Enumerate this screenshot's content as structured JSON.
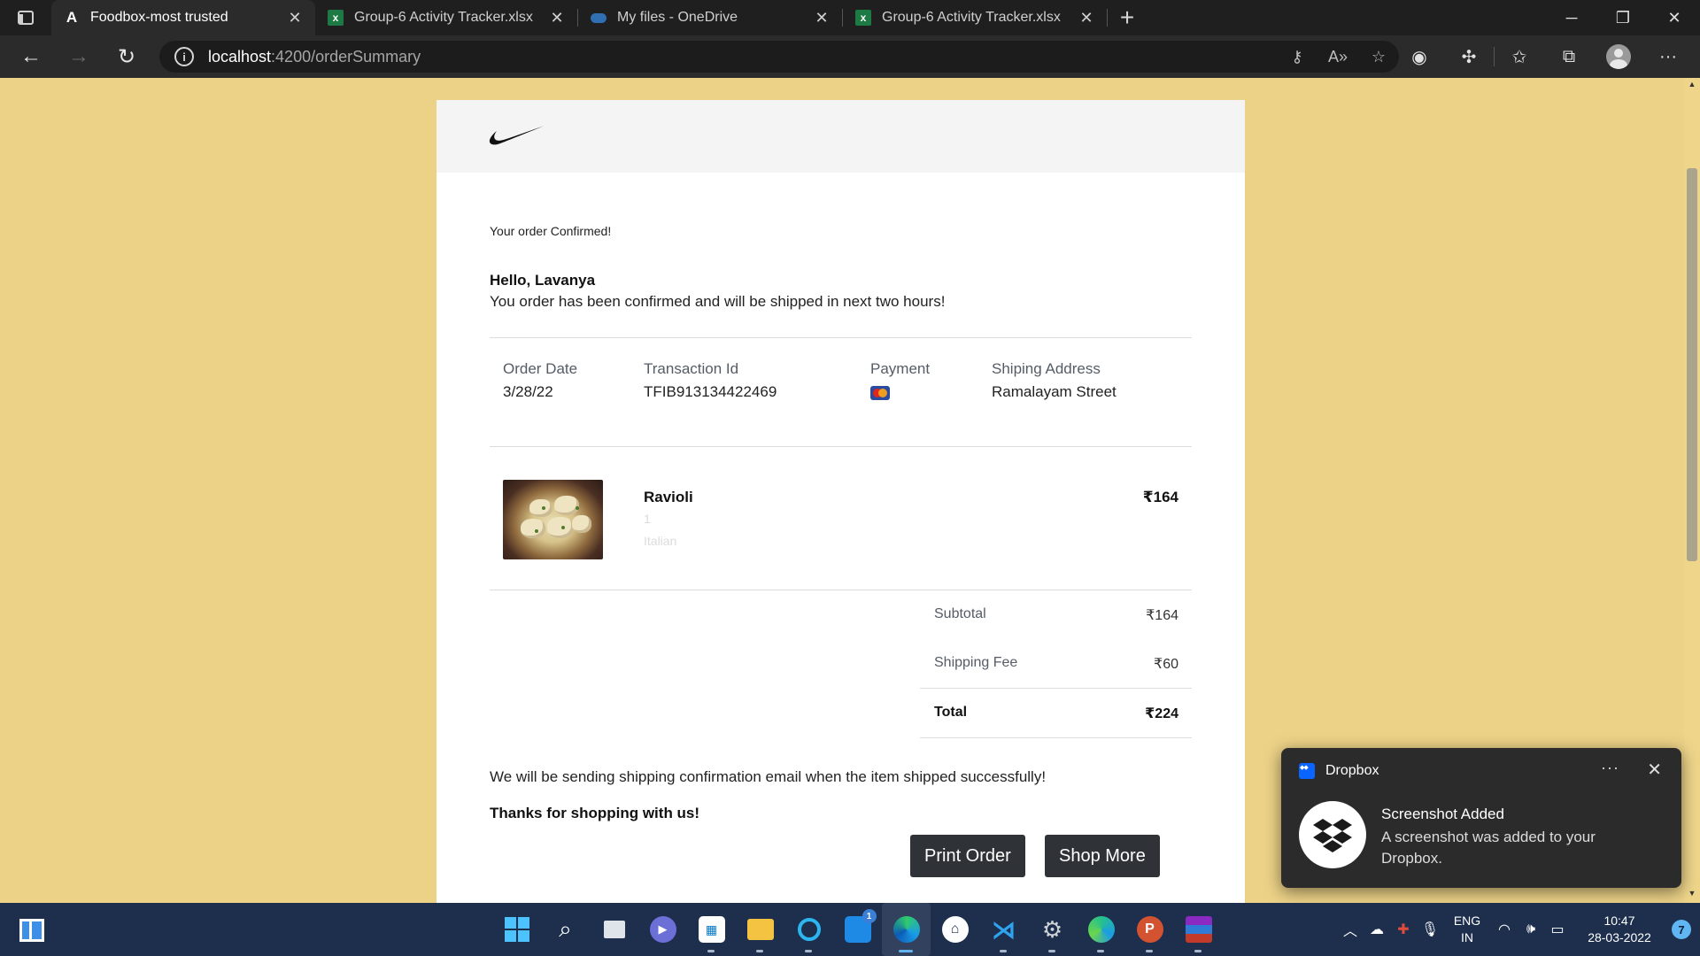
{
  "browser": {
    "tabs": [
      {
        "title": "Foodbox-most trusted",
        "icon": "angular-icon",
        "active": true
      },
      {
        "title": "Group-6 Activity Tracker.xlsx",
        "icon": "excel-icon",
        "active": false
      },
      {
        "title": "My files - OneDrive",
        "icon": "onedrive-icon",
        "active": false
      },
      {
        "title": "Group-6 Activity Tracker.xlsx",
        "icon": "excel-icon",
        "active": false
      }
    ],
    "url_host": "localhost",
    "url_path": ":4200/orderSummary"
  },
  "page": {
    "confirmed_text": "Your order Confirmed!",
    "greeting": "Hello, Lavanya",
    "message": "You order has been confirmed and will be shipped in next two hours!",
    "order_info": {
      "order_date_label": "Order Date",
      "order_date": "3/28/22",
      "transaction_label": "Transaction Id",
      "transaction_id": "TFIB913134422469",
      "payment_label": "Payment",
      "address_label": "Shiping Address",
      "address": "Ramalayam Street"
    },
    "item": {
      "name": "Ravioli",
      "quantity": "1",
      "category": "Italian",
      "price": "₹164"
    },
    "summary": {
      "subtotal_label": "Subtotal",
      "subtotal": "₹164",
      "shipping_label": "Shipping Fee",
      "shipping": "₹60",
      "total_label": "Total",
      "total": "₹224"
    },
    "shipping_note": "We will be sending shipping confirmation email when the item shipped successfully!",
    "thanks": "Thanks for shopping with us!",
    "print_button": "Print Order",
    "shop_button": "Shop More"
  },
  "toast": {
    "app": "Dropbox",
    "more": "···",
    "title": "Screenshot Added",
    "body": "A screenshot was added to your Dropbox."
  },
  "taskbar": {
    "lang_line1": "ENG",
    "lang_line2": "IN",
    "time": "10:47",
    "date": "28-03-2022",
    "notification_count": "7",
    "messenger_badge": "1"
  },
  "colors": {
    "page_background": "#ecd287",
    "button_background": "#2f3338",
    "taskbar": "#1e2f4e"
  }
}
